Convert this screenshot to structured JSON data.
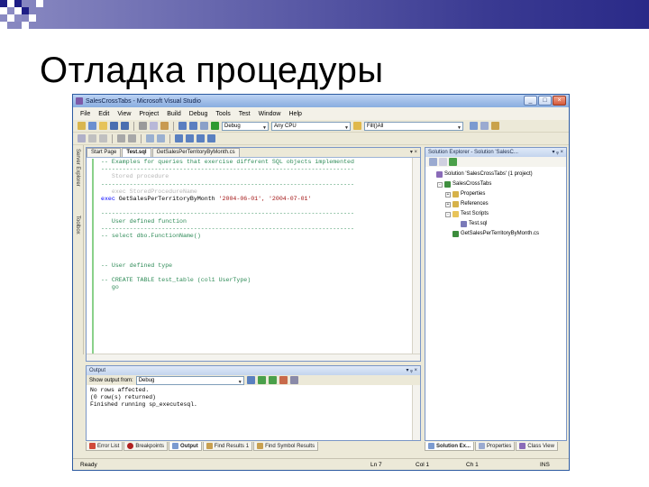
{
  "slide": {
    "title": "Отладка процедуры"
  },
  "window": {
    "title": "SalesCrossTabs - Microsoft Visual Studio",
    "min_label": "_",
    "max_label": "□",
    "close_label": "×"
  },
  "menu": [
    "File",
    "Edit",
    "View",
    "Project",
    "Build",
    "Debug",
    "Tools",
    "Test",
    "Window",
    "Help"
  ],
  "toolbar": {
    "config": "Debug",
    "platform": "Any CPU",
    "find": "Fill()All"
  },
  "left_strip": {
    "server_explorer": "Server Explorer",
    "toolbox": "Toolbox"
  },
  "editor": {
    "tabs": [
      "Start Page",
      "Test.sql",
      "GetSalesPerTerritoryByMonth.cs"
    ],
    "lines": [
      {
        "cls": "cm",
        "text": "-- Examples for queries that exercise different SQL objects implemented"
      },
      {
        "cls": "cm",
        "text": "-----------------------------------------------------------------------"
      },
      {
        "cls": "dim",
        "text": "   Stored procedure"
      },
      {
        "cls": "cm",
        "text": "-----------------------------------------------------------------------"
      },
      {
        "cls": "dim",
        "text": "   exec StoredProcedureName"
      },
      {
        "cls": "mix",
        "kw": "exec",
        "rest": " GetSalesPerTerritoryByMonth ",
        "str": "'2004-06-01', '2004-07-01'"
      },
      {
        "cls": "",
        "text": ""
      },
      {
        "cls": "cm",
        "text": "-----------------------------------------------------------------------"
      },
      {
        "cls": "cm",
        "text": "   User defined function"
      },
      {
        "cls": "cm",
        "text": "-----------------------------------------------------------------------"
      },
      {
        "cls": "cm",
        "text": "-- select dbo.FunctionName()"
      },
      {
        "cls": "",
        "text": ""
      },
      {
        "cls": "",
        "text": ""
      },
      {
        "cls": "",
        "text": ""
      },
      {
        "cls": "cm",
        "text": "-- User defined type"
      },
      {
        "cls": "",
        "text": ""
      },
      {
        "cls": "cm",
        "text": "-- CREATE TABLE test_table (col1 UserType)"
      },
      {
        "cls": "cm",
        "text": "   go"
      }
    ]
  },
  "solution_explorer": {
    "title": "Solution Explorer - Solution 'SalesC...",
    "controls": "▾ ᵩ ×",
    "items": [
      {
        "level": 0,
        "expander": "",
        "label": "Solution 'SalesCrossTabs' (1 project)",
        "color": "#8a6bb8"
      },
      {
        "level": 1,
        "expander": "-",
        "label": "SalesCrossTabs",
        "color": "#3f8f3f"
      },
      {
        "level": 2,
        "expander": "+",
        "label": "Properties",
        "color": "#d6b24a"
      },
      {
        "level": 2,
        "expander": "+",
        "label": "References",
        "color": "#d6b24a"
      },
      {
        "level": 2,
        "expander": "-",
        "label": "Test Scripts",
        "color": "#e8c45a"
      },
      {
        "level": 3,
        "expander": "",
        "label": "Test.sql",
        "color": "#7a7ab8"
      },
      {
        "level": 2,
        "expander": "",
        "label": "GetSalesPerTerritoryByMonth.cs",
        "color": "#3c8c3c"
      }
    ]
  },
  "output": {
    "title": "Output",
    "show_label": "Show output from:",
    "source": "Debug",
    "lines": [
      "No rows affected.",
      "(0 row(s) returned)",
      "Finished running sp_executesql."
    ]
  },
  "bottom_tabs": [
    "Error List",
    "Breakpoints",
    "Output",
    "Find Results 1",
    "Find Symbol Results"
  ],
  "right_tabs": [
    "Solution Ex...",
    "Properties",
    "Class View"
  ],
  "status": {
    "ready": "Ready",
    "ln": "Ln 7",
    "col": "Col 1",
    "ch": "Ch 1",
    "ins": "INS"
  }
}
